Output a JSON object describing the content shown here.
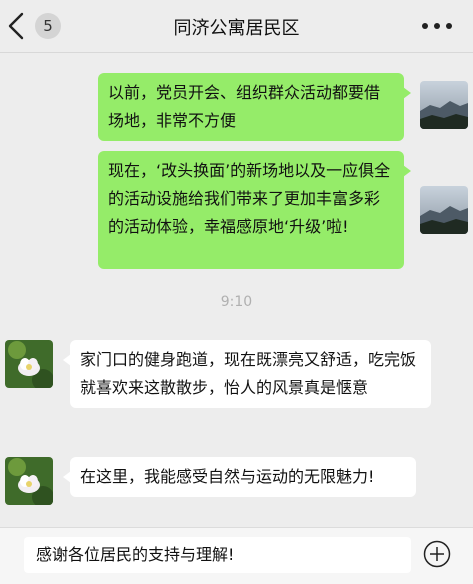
{
  "header": {
    "title": "同济公寓居民区",
    "unread_count": "5"
  },
  "messages": [
    {
      "side": "sent",
      "text": "以前，党员开会、组织群众活动都要借场地，非常不方便"
    },
    {
      "side": "sent",
      "text": "现在，‘改头换面’的新场地以及一应俱全的活动设施给我们带来了更加丰富多彩的活动体验，幸福感原地‘升级’啦!"
    },
    {
      "side": "recv",
      "text": "家门口的健身跑道，现在既漂亮又舒适，吃完饭就喜欢来这散散步，怡人的风景真是惬意"
    },
    {
      "side": "recv",
      "text": "在这里，我能感受自然与运动的无限魅力!"
    }
  ],
  "timestamp": "9:10",
  "input": {
    "value": "感谢各位居民的支持与理解!"
  },
  "colors": {
    "background": "#ededed",
    "sent_bubble": "#95ec69",
    "recv_bubble": "#ffffff"
  },
  "icons": {
    "back": "chevron-left-icon",
    "more": "more-dots-icon",
    "plus": "plus-circle-icon"
  }
}
